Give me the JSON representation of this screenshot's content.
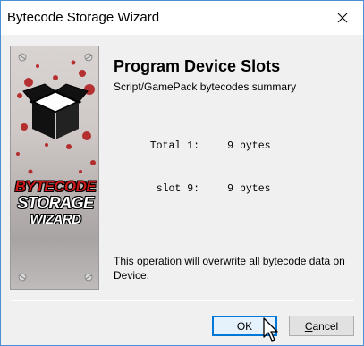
{
  "window": {
    "title": "Bytecode Storage Wizard"
  },
  "banner": {
    "line1": "BYTECODE",
    "line2": "STORAGE",
    "line3": "WIZARD"
  },
  "content": {
    "heading": "Program Device Slots",
    "subheading": "Script/GamePack bytecodes summary",
    "summary": [
      {
        "label": "Total 1:",
        "value": "9",
        "unit": "bytes"
      },
      {
        "label": "slot 9:",
        "value": "9",
        "unit": "bytes"
      }
    ],
    "warning": "This operation will overwrite all bytecode data on Device."
  },
  "buttons": {
    "ok": "OK",
    "cancel_underlined": "C",
    "cancel_rest": "ancel"
  },
  "colors": {
    "accent": "#0078d7",
    "banner_red": "#c81818"
  }
}
